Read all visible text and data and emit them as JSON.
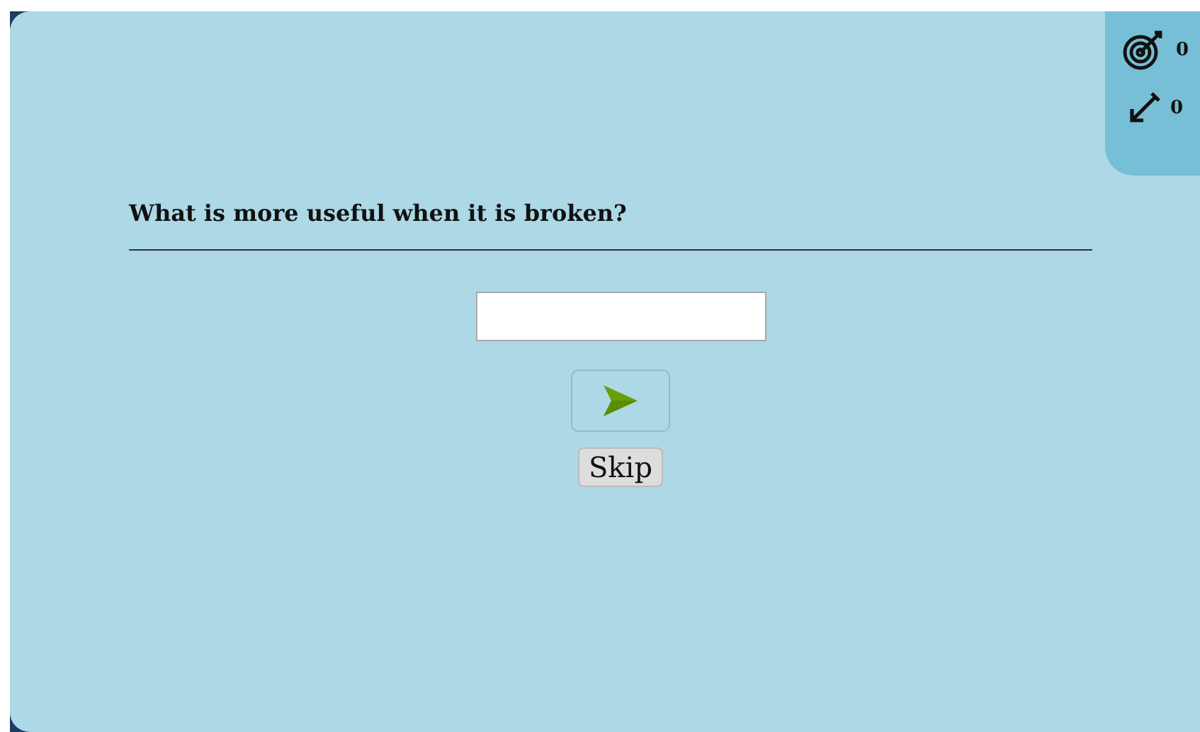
{
  "scores": [
    {
      "kind": "hits",
      "value": "0"
    },
    {
      "kind": "shots",
      "value": "0"
    }
  ],
  "question": "What is more useful when it is broken?",
  "skip_button": "Skip"
}
